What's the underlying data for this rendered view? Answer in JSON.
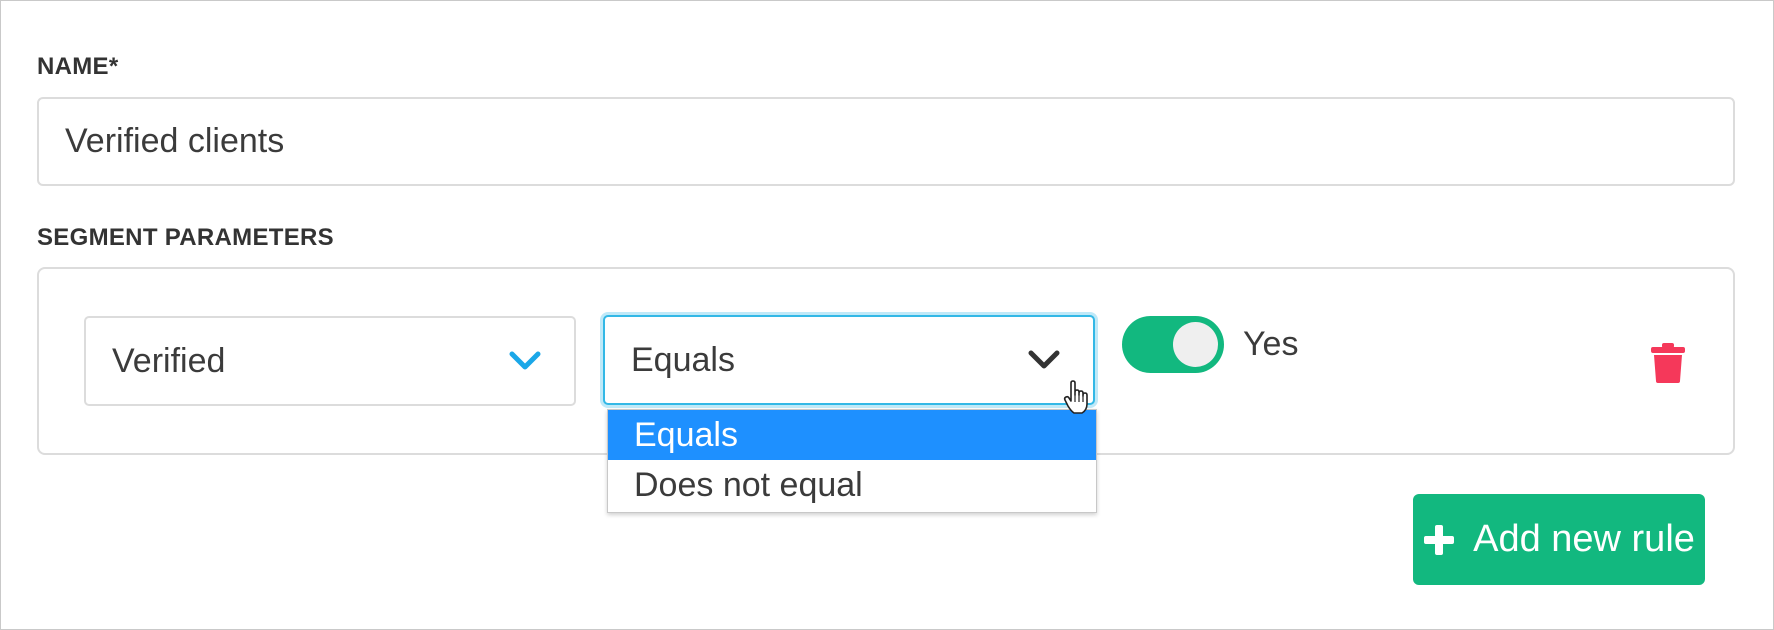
{
  "form": {
    "name_label": "NAME*",
    "name_value": "Verified clients",
    "segment_label": "SEGMENT PARAMETERS"
  },
  "rule": {
    "field_value": "Verified",
    "operator_value": "Equals",
    "operator_options": [
      "Equals",
      "Does not equal"
    ],
    "toggle_on": true,
    "toggle_label": "Yes"
  },
  "actions": {
    "add_rule_label": "Add new rule"
  },
  "icons": {
    "field_chevron": "chevron-down-icon",
    "operator_chevron": "chevron-down-icon",
    "delete": "trash-icon",
    "add": "plus-icon",
    "cursor": "hand-pointer-icon"
  },
  "colors": {
    "accent_green": "#12b87f",
    "selected_option": "#1e90ff",
    "focus_border": "#33b8e6",
    "field_chevron": "#1aa7e8",
    "delete_icon": "#f5385a"
  }
}
